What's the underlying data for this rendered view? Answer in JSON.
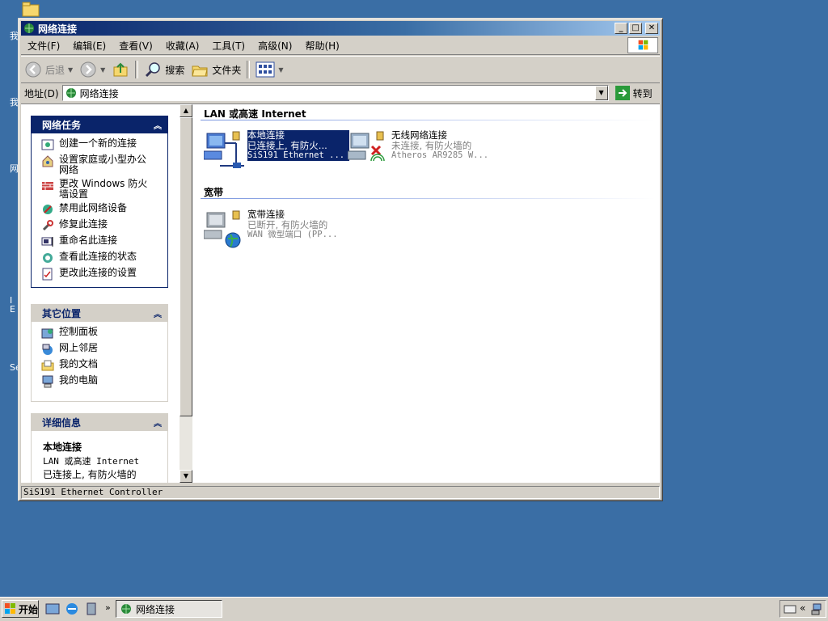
{
  "window": {
    "title": "网络连接"
  },
  "menu": [
    "文件(F)",
    "编辑(E)",
    "查看(V)",
    "收藏(A)",
    "工具(T)",
    "高级(N)",
    "帮助(H)"
  ],
  "toolbar": {
    "back": "后退",
    "search": "搜索",
    "folders": "文件夹"
  },
  "address": {
    "label": "地址(D)",
    "value": "网络连接",
    "go": "转到"
  },
  "tasks_panel": {
    "title": "网络任务",
    "items": [
      {
        "label": "创建一个新的连接",
        "icon": "new-connection-icon"
      },
      {
        "label": "设置家庭或小型办公网络",
        "icon": "home-network-icon"
      },
      {
        "label": "更改 Windows 防火墙设置",
        "icon": "firewall-icon"
      },
      {
        "label": "禁用此网络设备",
        "icon": "disable-device-icon"
      },
      {
        "label": "修复此连接",
        "icon": "repair-icon"
      },
      {
        "label": "重命名此连接",
        "icon": "rename-icon"
      },
      {
        "label": "查看此连接的状态",
        "icon": "status-icon"
      },
      {
        "label": "更改此连接的设置",
        "icon": "settings-icon"
      }
    ]
  },
  "other_places": {
    "title": "其它位置",
    "items": [
      {
        "label": "控制面板",
        "icon": "control-panel-icon"
      },
      {
        "label": "网上邻居",
        "icon": "network-places-icon"
      },
      {
        "label": "我的文档",
        "icon": "my-documents-icon"
      },
      {
        "label": "我的电脑",
        "icon": "my-computer-icon"
      }
    ]
  },
  "details": {
    "title": "详细信息",
    "name": "本地连接",
    "type": "LAN 或高速 Internet",
    "status": "已连接上, 有防火墙的"
  },
  "sections": {
    "lan": "LAN 或高速 Internet",
    "broadband": "宽带"
  },
  "connections": {
    "local": {
      "name": "本地连接",
      "status": "已连接上, 有防火...",
      "device": "SiS191 Ethernet ..."
    },
    "wireless": {
      "name": "无线网络连接",
      "status": "未连接, 有防火墙的",
      "device": "Atheros AR9285 W..."
    },
    "broadband": {
      "name": "宽带连接",
      "status": "已断开, 有防火墙的",
      "device": "WAN 微型端口 (PP..."
    }
  },
  "statusbar": "SiS191 Ethernet Controller",
  "taskbar": {
    "start": "开始",
    "task": "网络连接"
  },
  "colors": {
    "desktop": "#3a6ea5",
    "titlebar": "#0a246a",
    "selection": "#0a246a"
  }
}
